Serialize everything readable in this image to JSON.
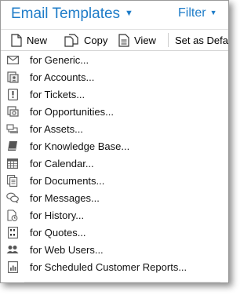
{
  "header": {
    "title": "Email Templates",
    "filter_label": "Filter"
  },
  "toolbar": {
    "new_label": "New",
    "copy_label": "Copy",
    "view_label": "View",
    "set_default_label": "Set as Defa"
  },
  "items": [
    {
      "label": "for Generic...",
      "icon": "envelope-icon"
    },
    {
      "label": "for Accounts...",
      "icon": "contact-card-icon"
    },
    {
      "label": "for Tickets...",
      "icon": "ticket-icon"
    },
    {
      "label": "for Opportunities...",
      "icon": "opportunity-icon"
    },
    {
      "label": "for Assets...",
      "icon": "assets-icon"
    },
    {
      "label": "for Knowledge Base...",
      "icon": "book-icon"
    },
    {
      "label": "for Calendar...",
      "icon": "calendar-icon"
    },
    {
      "label": "for Documents...",
      "icon": "documents-icon"
    },
    {
      "label": "for Messages...",
      "icon": "speech-bubbles-icon"
    },
    {
      "label": "for History...",
      "icon": "history-icon"
    },
    {
      "label": "for Quotes...",
      "icon": "quote-icon"
    },
    {
      "label": "for Web Users...",
      "icon": "users-icon"
    },
    {
      "label": "for Scheduled Customer Reports...",
      "icon": "report-icon"
    }
  ],
  "colors": {
    "accent": "#1e7cc8",
    "icon_gray": "#5f5f5f"
  }
}
